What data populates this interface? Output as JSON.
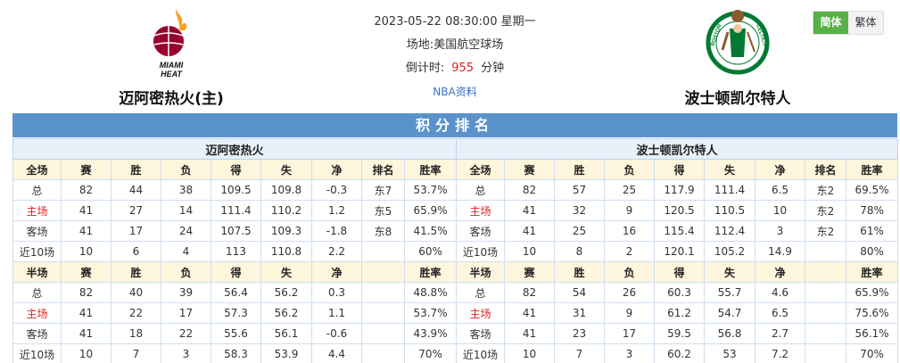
{
  "match": {
    "datetime": "2023-05-22 08:30:00 星期一",
    "venue_label": "场地:",
    "venue": "美国航空球场",
    "countdown_label": "倒计时:",
    "countdown_value": "955",
    "countdown_unit": "分钟",
    "nba_link": "NBA资料"
  },
  "home_team": {
    "name": "迈阿密热火(主)",
    "logo_text": "MIAMI HEAT"
  },
  "away_team": {
    "name": "波士顿凯尔特人",
    "logo_text": "BOSTON CELTICS"
  },
  "lang": {
    "simplified": "简体",
    "traditional": "繁体"
  },
  "ranking": {
    "title": "积分排名",
    "left": {
      "team": "迈阿密热火",
      "full_header": [
        "全场",
        "赛",
        "胜",
        "负",
        "得",
        "失",
        "净",
        "排名",
        "胜率"
      ],
      "full_rows": [
        [
          "总",
          "82",
          "44",
          "38",
          "109.5",
          "109.8",
          "-0.3",
          "东7",
          "53.7%"
        ],
        [
          "主场",
          "41",
          "27",
          "14",
          "111.4",
          "110.2",
          "1.2",
          "东5",
          "65.9%"
        ],
        [
          "客场",
          "41",
          "17",
          "24",
          "107.5",
          "109.3",
          "-1.8",
          "东8",
          "41.5%"
        ],
        [
          "近10场",
          "10",
          "6",
          "4",
          "113",
          "110.8",
          "2.2",
          "",
          "60%"
        ]
      ],
      "half_header": [
        "半场",
        "赛",
        "胜",
        "负",
        "得",
        "失",
        "净",
        "",
        "胜率"
      ],
      "half_rows": [
        [
          "总",
          "82",
          "40",
          "39",
          "56.4",
          "56.2",
          "0.3",
          "",
          "48.8%"
        ],
        [
          "主场",
          "41",
          "22",
          "17",
          "57.3",
          "56.2",
          "1.1",
          "",
          "53.7%"
        ],
        [
          "客场",
          "41",
          "18",
          "22",
          "55.6",
          "56.1",
          "-0.6",
          "",
          "43.9%"
        ],
        [
          "近10场",
          "10",
          "7",
          "3",
          "58.3",
          "53.9",
          "4.4",
          "",
          "70%"
        ]
      ]
    },
    "right": {
      "team": "波士顿凯尔特人",
      "full_header": [
        "全场",
        "赛",
        "胜",
        "负",
        "得",
        "失",
        "净",
        "排名",
        "胜率"
      ],
      "full_rows": [
        [
          "总",
          "82",
          "57",
          "25",
          "117.9",
          "111.4",
          "6.5",
          "东2",
          "69.5%"
        ],
        [
          "主场",
          "41",
          "32",
          "9",
          "120.5",
          "110.5",
          "10",
          "东2",
          "78%"
        ],
        [
          "客场",
          "41",
          "25",
          "16",
          "115.4",
          "112.4",
          "3",
          "东2",
          "61%"
        ],
        [
          "近10场",
          "10",
          "8",
          "2",
          "120.1",
          "105.2",
          "14.9",
          "",
          "80%"
        ]
      ],
      "half_header": [
        "半场",
        "赛",
        "胜",
        "负",
        "得",
        "失",
        "净",
        "",
        "胜率"
      ],
      "half_rows": [
        [
          "总",
          "82",
          "54",
          "26",
          "60.3",
          "55.7",
          "4.6",
          "",
          "65.9%"
        ],
        [
          "主场",
          "41",
          "31",
          "9",
          "61.2",
          "54.7",
          "6.5",
          "",
          "75.6%"
        ],
        [
          "客场",
          "41",
          "23",
          "17",
          "59.5",
          "56.8",
          "2.7",
          "",
          "56.1%"
        ],
        [
          "近10场",
          "10",
          "7",
          "3",
          "60.2",
          "53",
          "7.2",
          "",
          "70%"
        ]
      ]
    }
  },
  "colors": {
    "accent_blue": "#5a93cc",
    "home_red": "#e02020",
    "lang_active": "#5ab048"
  }
}
